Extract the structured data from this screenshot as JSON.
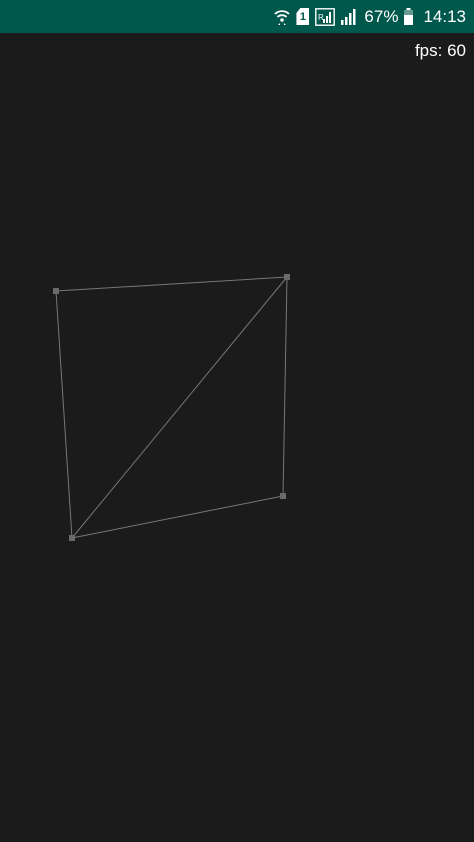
{
  "status_bar": {
    "sim_label": "1",
    "battery_percent": "67%",
    "time": "14:13",
    "icons": [
      "wifi-icon",
      "sim-icon",
      "signal-r-icon",
      "signal-icon",
      "battery-icon"
    ]
  },
  "fps_label": "fps: 60",
  "colors": {
    "background": "#1b1b1b",
    "status_bar": "#00574b",
    "line": "#777777",
    "vertex": "#6a6a6a"
  },
  "mesh": {
    "vertex_count": 4,
    "edge_count": 5
  }
}
